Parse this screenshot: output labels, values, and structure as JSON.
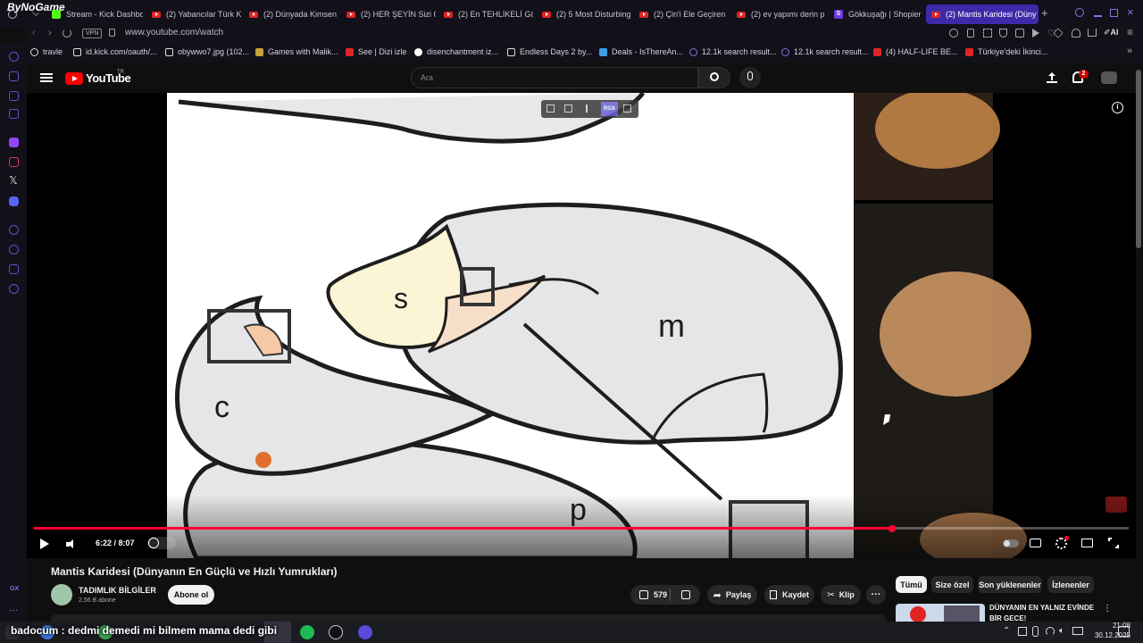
{
  "browser": {
    "brand": "ByNoGame",
    "url": "www.youtube.com/watch",
    "vpn_label": "VPN",
    "ai_label": "AI",
    "tabs": [
      {
        "label": "Stream - Kick Dashbo"
      },
      {
        "label": "(2) Yabancılar Türk K"
      },
      {
        "label": "(2) Dünyada Kimsen"
      },
      {
        "label": "(2) HER ŞEYİN Sizi Ö"
      },
      {
        "label": "(2) En TEHLİKELİ Gö"
      },
      {
        "label": "(2) 5 Most Disturbing"
      },
      {
        "label": "(2) Çin'i Ele Geçiren"
      },
      {
        "label": "(2) ev yapımı derin p"
      },
      {
        "label": "Gökkuşağı | Shopier"
      },
      {
        "label": "(2) Mantis Karidesi (Düny"
      }
    ],
    "bookmarks": [
      {
        "label": "travle"
      },
      {
        "label": "id.kick.com/oauth/..."
      },
      {
        "label": "obywwo7.jpg (102..."
      },
      {
        "label": "Games with Malik..."
      },
      {
        "label": "See | Dizi izle"
      },
      {
        "label": "disenchantment iz..."
      },
      {
        "label": "Endless Days 2 by..."
      },
      {
        "label": "Deals - IsThereAn..."
      },
      {
        "label": "12.1k search result..."
      },
      {
        "label": "12.1k search result..."
      },
      {
        "label": "(4) HALF-LIFE BE..."
      },
      {
        "label": "Türkiye'deki İkinci..."
      }
    ]
  },
  "youtube": {
    "logo_text": "YouTube",
    "logo_region": "TR",
    "search_placeholder": "Ara",
    "notification_count": "2",
    "video": {
      "time_display": "6:22 / 8:07",
      "progress": 0.784,
      "diagram_labels": {
        "s": "s",
        "m": "m",
        "c": "c",
        "p": "p"
      },
      "overlay_badge": "RGX",
      "title": "Mantis Karidesi (Dünyanın En Güçlü ve Hızlı Yumrukları)"
    },
    "channel": {
      "name": "TADIMLIK BİLGİLER",
      "subs": "2,56 B abone",
      "subscribe_label": "Abone ol"
    },
    "actions": {
      "like_count": "579",
      "share": "Paylaş",
      "save": "Kaydet",
      "clip": "Klip"
    },
    "chips": [
      "Tümü",
      "Size özel",
      "Son yüklenenler",
      "İzlenenler"
    ],
    "recommendation": {
      "title_line1": "DÜNYANIN EN YALNIZ EVİNDE",
      "title_line2": "BİR GECE!"
    }
  },
  "rail": {
    "gx_label": "GX"
  },
  "taskbar": {
    "marquee": "badocum : dedmi demedi mi bilmem mama dedi gibi",
    "time": "21:08",
    "date": "30.12.2025"
  },
  "colors": {
    "accent": "#3c2aa8",
    "progress": "#ff0033",
    "youtube_red": "#ff0000"
  }
}
